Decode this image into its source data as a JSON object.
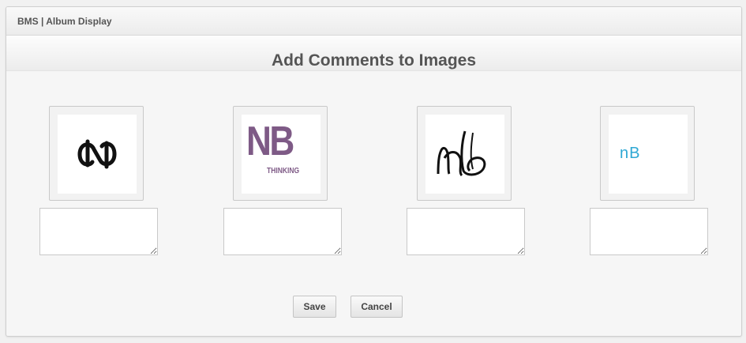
{
  "window": {
    "title": "BMS | Album Display"
  },
  "page": {
    "heading": "Add Comments to Images"
  },
  "images": [
    {
      "logo": "nd-interlocked-logo",
      "comment": ""
    },
    {
      "logo": "nb-thinking-logo",
      "logo_text_main": "NB",
      "logo_text_sub": "THINKING",
      "comment": ""
    },
    {
      "logo": "nb-script-logo",
      "comment": ""
    },
    {
      "logo": "nb-circle-logo",
      "logo_text_main": "nB",
      "comment": ""
    }
  ],
  "actions": {
    "save_label": "Save",
    "cancel_label": "Cancel"
  },
  "colors": {
    "purple_logo": "#7e5a86",
    "teal_logo": "#2fa8d4"
  }
}
